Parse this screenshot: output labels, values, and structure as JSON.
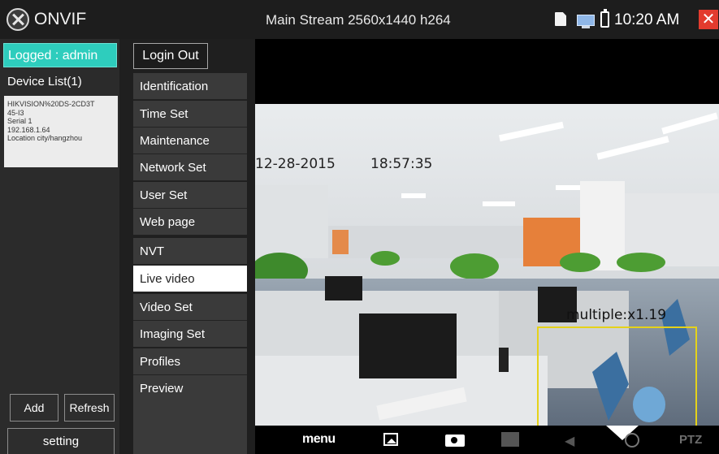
{
  "topbar": {
    "app_title": "ONVIF",
    "stream_title": "Main Stream 2560x1440 h264",
    "clock": "10:20 AM",
    "icons": [
      "onvif-logo-icon",
      "sd-card-icon",
      "monitor-icon",
      "battery-icon",
      "close-icon"
    ]
  },
  "sidebar": {
    "logged": "Logged : admin",
    "device_list_title": "Device List(1)",
    "device": {
      "name": "HIKVISION%20DS-2CD3T\n45-I3",
      "serial": "Serial 1",
      "ip": "192.168.1.64",
      "location": "Location city/hangzhou"
    },
    "add_label": "Add",
    "refresh_label": "Refresh",
    "setting_label": "setting"
  },
  "menu": {
    "login_out": "Login Out",
    "items": [
      {
        "label": "Identification"
      },
      {
        "label": "Time Set"
      },
      {
        "label": "Maintenance"
      },
      {
        "label": "Network Set"
      },
      {
        "label": "User Set"
      },
      {
        "label": "Web page"
      },
      {
        "label": "NVT"
      },
      {
        "label": "Live video"
      },
      {
        "label": "Video Set"
      },
      {
        "label": "Imaging Set"
      },
      {
        "label": "Profiles"
      },
      {
        "label": "Preview"
      }
    ],
    "active_item": "Live video"
  },
  "video": {
    "osd_date": "12-28-2015",
    "osd_time": "18:57:35",
    "zoom_label": "multiple:x1.19",
    "zoom_box_color": "#e5d21a"
  },
  "toolbar": {
    "menu_label": "menu",
    "ptz_label": "PTZ",
    "icons": [
      "image-icon",
      "camera-icon",
      "record-icon",
      "mute-icon",
      "down-arrow-icon",
      "play-icon"
    ]
  },
  "colors": {
    "accent": "#2ecdbd",
    "close": "#e33b2e",
    "active_menu_bg": "#ffffff"
  }
}
